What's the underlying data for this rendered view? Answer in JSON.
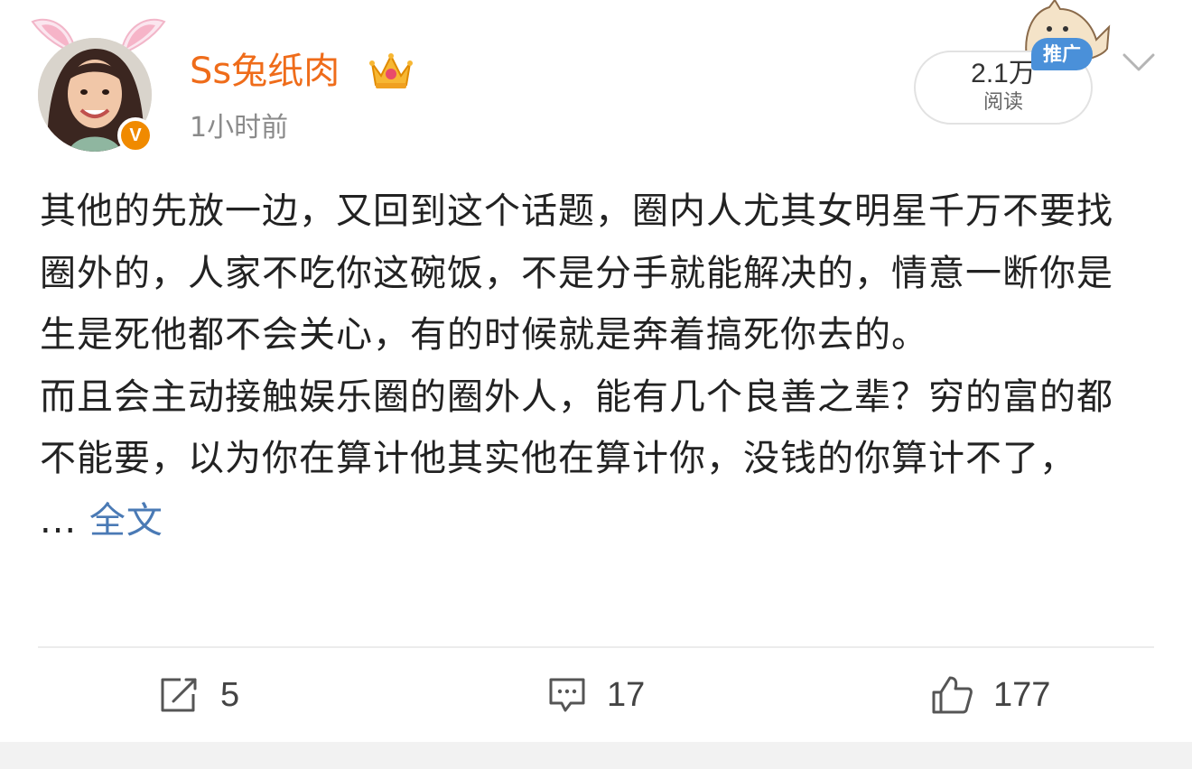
{
  "user": {
    "name": "Ss兔纸肉",
    "time": "1小时前",
    "verified_badge": "V"
  },
  "reads": {
    "count": "2.1万",
    "label": "阅读",
    "promo_label": "推广"
  },
  "post": {
    "text": "其他的先放一边，又回到这个话题，圈内人尤其女明星千万不要找圈外的，人家不吃你这碗饭，不是分手就能解决的，情意一断你是生是死他都不会关心，有的时候就是奔着搞死你去的。\n而且会主动接触娱乐圈的圈外人，能有几个良善之辈？穷的富的都不能要，以为你在算计他其实他在算计你，没钱的你算计不了，",
    "ellipsis": " ... ",
    "more_label": "全文"
  },
  "actions": {
    "share_count": "5",
    "comment_count": "17",
    "like_count": "177"
  },
  "icons": {
    "share": "share-edit-icon",
    "comment": "comment-icon",
    "like": "thumbs-up-icon",
    "menu": "chevron-down-icon",
    "crown": "crown-icon",
    "ears": "bunny-ears-icon"
  },
  "colors": {
    "username": "#ef6c1a",
    "link": "#4a7ab5",
    "verified": "#f08a00",
    "promo": "#4a90d9"
  }
}
